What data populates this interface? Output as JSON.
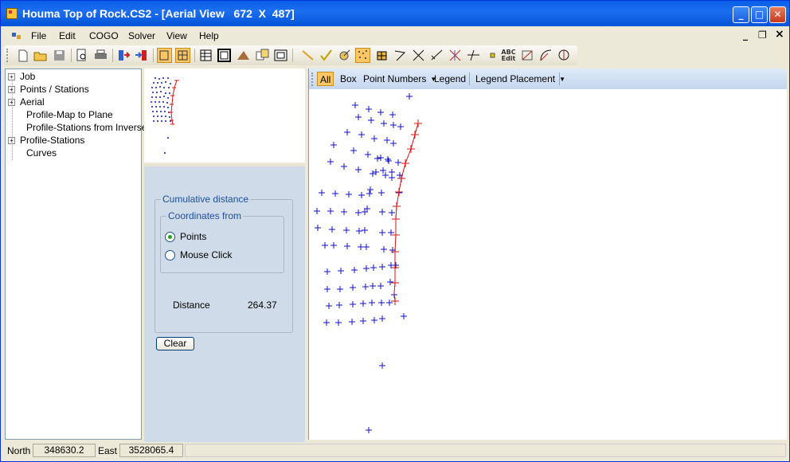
{
  "window": {
    "title": "Houma Top of Rock.CS2 - [Aerial View   672  X  487]",
    "minimize": "_",
    "maximize": "□",
    "close": "✕"
  },
  "menu": {
    "items": [
      "File",
      "Edit",
      "COGO",
      "Solver",
      "View",
      "Help"
    ],
    "mdi_min": "_",
    "mdi_restore": "❐",
    "mdi_close": "×"
  },
  "toolbar": {
    "icons": [
      "new-document-icon",
      "open-folder-icon",
      "save-icon",
      "print-preview-icon",
      "print-icon",
      "import-icon",
      "export-icon",
      "toggle-a-icon",
      "toggle-b-icon",
      "grid-table-icon",
      "map-frame-icon",
      "profile-icon",
      "copy-view-icon",
      "window-icon",
      "line-icon",
      "check-icon",
      "target-icon",
      "points-icon",
      "zoom-extent-icon",
      "angle-icon",
      "cross-icon",
      "diagonal-icon",
      "intersect-icon",
      "offset-icon",
      "point-icon",
      "abc-edit-icon",
      "traverse-icon",
      "curve-icon",
      "circle-icon"
    ],
    "abc_label": "ABC Edit"
  },
  "tree": {
    "items": [
      {
        "label": "Job",
        "expandable": true
      },
      {
        "label": "Points / Stations",
        "expandable": true
      },
      {
        "label": "Aerial",
        "expandable": true
      },
      {
        "label": "Profile-Map to Plane",
        "expandable": false
      },
      {
        "label": "Profile-Stations from Inverse",
        "expandable": false
      },
      {
        "label": "Profile-Stations",
        "expandable": true
      },
      {
        "label": "Curves",
        "expandable": false
      }
    ]
  },
  "distance_panel": {
    "group_title": "Cumulative distance",
    "coords_title": "Coordinates from",
    "option_points": "Points",
    "option_mouse": "Mouse Click",
    "selected": "Points",
    "distance_label": "Distance",
    "distance_value": "264.37",
    "clear_button": "Clear"
  },
  "view_toolbar": {
    "all": "All",
    "box": "Box",
    "point_numbers": "Point Numbers",
    "legend": "Legend",
    "legend_placement": "Legend Placement"
  },
  "colors": {
    "points": "#1010C8",
    "alignment": "#D81010",
    "active": "#FBC665"
  },
  "status": {
    "north_label": "North",
    "north_value": "348630.2",
    "east_label": "East",
    "east_value": "3528065.4"
  }
}
